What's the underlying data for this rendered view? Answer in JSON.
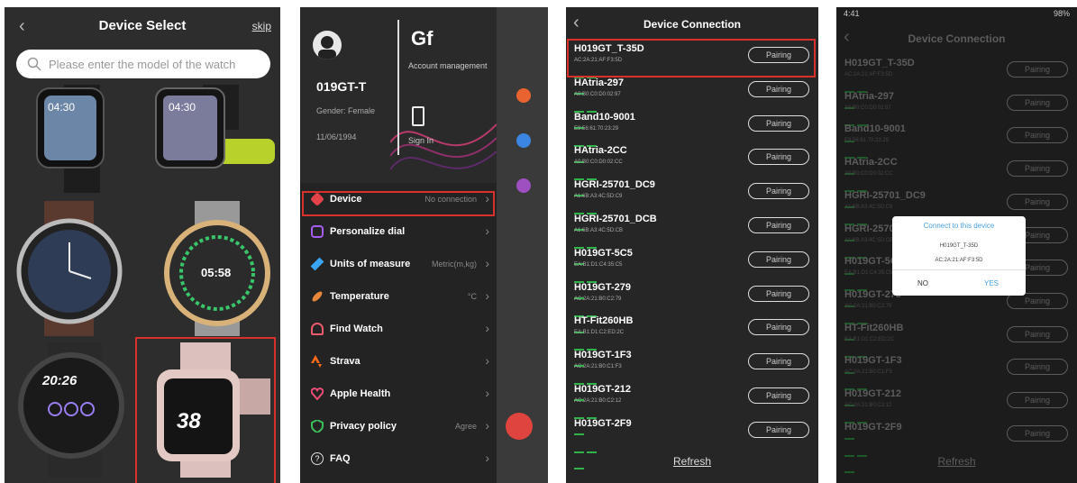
{
  "screen1": {
    "title": "Device Select",
    "skip_label": "skip",
    "search_placeholder": "Please enter the model of the watch",
    "watch_times": [
      "04:30",
      "04:30",
      "",
      "05:58",
      "20:26",
      "38"
    ]
  },
  "screen2": {
    "user_name": "019GT-T",
    "gender": "Gender: Female",
    "birthday": "11/06/1994",
    "account_logo": "Gf",
    "account_label": "Account management",
    "signin_label": "Sign In",
    "menu": [
      {
        "label": "Device",
        "value": "No connection",
        "icon": "watch-icon",
        "color": "#e4434a"
      },
      {
        "label": "Personalize dial",
        "value": "",
        "icon": "dial-icon",
        "color": "#a55cf0"
      },
      {
        "label": "Units of measure",
        "value": "Metric(m,kg)",
        "icon": "ruler-icon",
        "color": "#3aa5f3"
      },
      {
        "label": "Temperature",
        "value": "°C",
        "icon": "thermometer-icon",
        "color": "#e8873a"
      },
      {
        "label": "Find Watch",
        "value": "",
        "icon": "bell-icon",
        "color": "#e95a6b"
      },
      {
        "label": "Strava",
        "value": "",
        "icon": "strava-icon",
        "color": "#fc6a1c"
      },
      {
        "label": "Apple Health",
        "value": "",
        "icon": "heart-icon",
        "color": "#ef4e78"
      },
      {
        "label": "Privacy policy",
        "value": "Agree",
        "icon": "shield-icon",
        "color": "#3cbf5a"
      },
      {
        "label": "FAQ",
        "value": "",
        "icon": "question-icon",
        "color": "#dddddd"
      }
    ]
  },
  "screen3": {
    "title": "Device Connection",
    "pair_label": "Pairing",
    "refresh_label": "Refresh",
    "devices": [
      {
        "name": "H019GT_T-35D",
        "mac": "AC:2A:21:AF:F3:5D"
      },
      {
        "name": "HAtria-297",
        "mac": "A0:B0:C0:D0:02:97"
      },
      {
        "name": "Band10-9001",
        "mac": "E9:56:61:70:23:29"
      },
      {
        "name": "HAtria-2CC",
        "mac": "A0:B0:C0:D0:02:CC"
      },
      {
        "name": "HGRI-25701_DC9",
        "mac": "A1:6B:A3:4C:5D:C9"
      },
      {
        "name": "HGRI-25701_DCB",
        "mac": "A1:6B:A3:4C:5D:CB"
      },
      {
        "name": "H019GT-5C5",
        "mac": "EA:B1:D1:C4:35:C5"
      },
      {
        "name": "H019GT-279",
        "mac": "AC:2A:21:B0:C2:79"
      },
      {
        "name": "HT-Fit260HB",
        "mac": "EA:B1:D1:C2:ED:2C"
      },
      {
        "name": "H019GT-1F3",
        "mac": "AC:2A:21:B0:C1:F3"
      },
      {
        "name": "H019GT-212",
        "mac": "AC:2A:21:B0:C2:12"
      },
      {
        "name": "H019GT-2F9",
        "mac": ""
      }
    ]
  },
  "screen4": {
    "status_time": "4:41",
    "status_right": "98%",
    "title": "Device Connection",
    "dialog": {
      "title": "Connect to this device",
      "name": "H019GT_T-35D",
      "mac": "AC:2A:21:AF:F3:5D",
      "no": "NO",
      "yes": "YES"
    }
  },
  "colors": {
    "accent_red": "#d9302c",
    "signal_green": "#2fb34a",
    "dialog_blue": "#4aa3e0"
  }
}
